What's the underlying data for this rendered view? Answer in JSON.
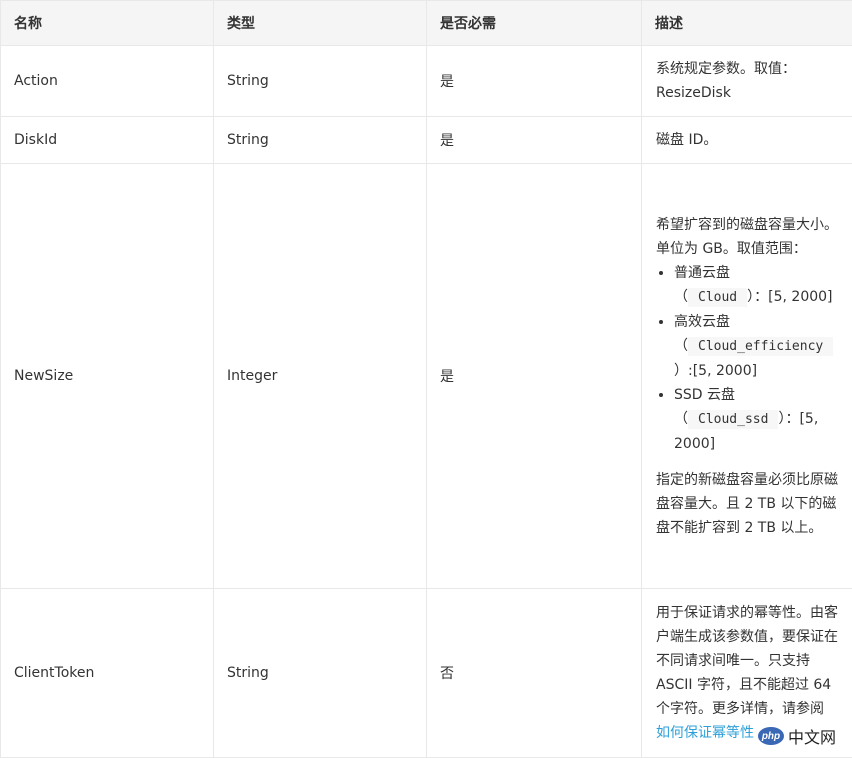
{
  "headers": [
    "名称",
    "类型",
    "是否必需",
    "描述"
  ],
  "rows": [
    {
      "name": "Action",
      "type": "String",
      "required": "是",
      "desc": "系统规定参数。取值：ResizeDisk"
    },
    {
      "name": "DiskId",
      "type": "String",
      "required": "是",
      "desc": "磁盘 ID。"
    },
    {
      "name": "NewSize",
      "type": "Integer",
      "required": "是",
      "desc_intro": "希望扩容到的磁盘容量大小。单位为 GB。取值范围：",
      "items": [
        {
          "label": "普通云盘",
          "open": "（",
          "code": "Cloud",
          "close": "）：[5, 2000]"
        },
        {
          "label": "高效云盘",
          "open": "（",
          "code": "Cloud_efficiency",
          "close": "）:[5, 2000]"
        },
        {
          "label": "SSD 云盘",
          "open": "（",
          "code": "Cloud_ssd",
          "close": "）：[5, 2000]"
        }
      ],
      "desc_note": "指定的新磁盘容量必须比原磁盘容量大。且 2 TB 以下的磁盘不能扩容到 2 TB 以上。"
    },
    {
      "name": "ClientToken",
      "type": "String",
      "required": "否",
      "desc": "用于保证请求的幂等性。由客户端生成该参数值，要保证在不同请求间唯一。只支持 ASCII 字符，且不能超过 64 个字符。更多详情，请参阅 ",
      "link": "如何保证幂等性"
    }
  ],
  "watermark": {
    "logo": "php",
    "text": "中文网"
  }
}
